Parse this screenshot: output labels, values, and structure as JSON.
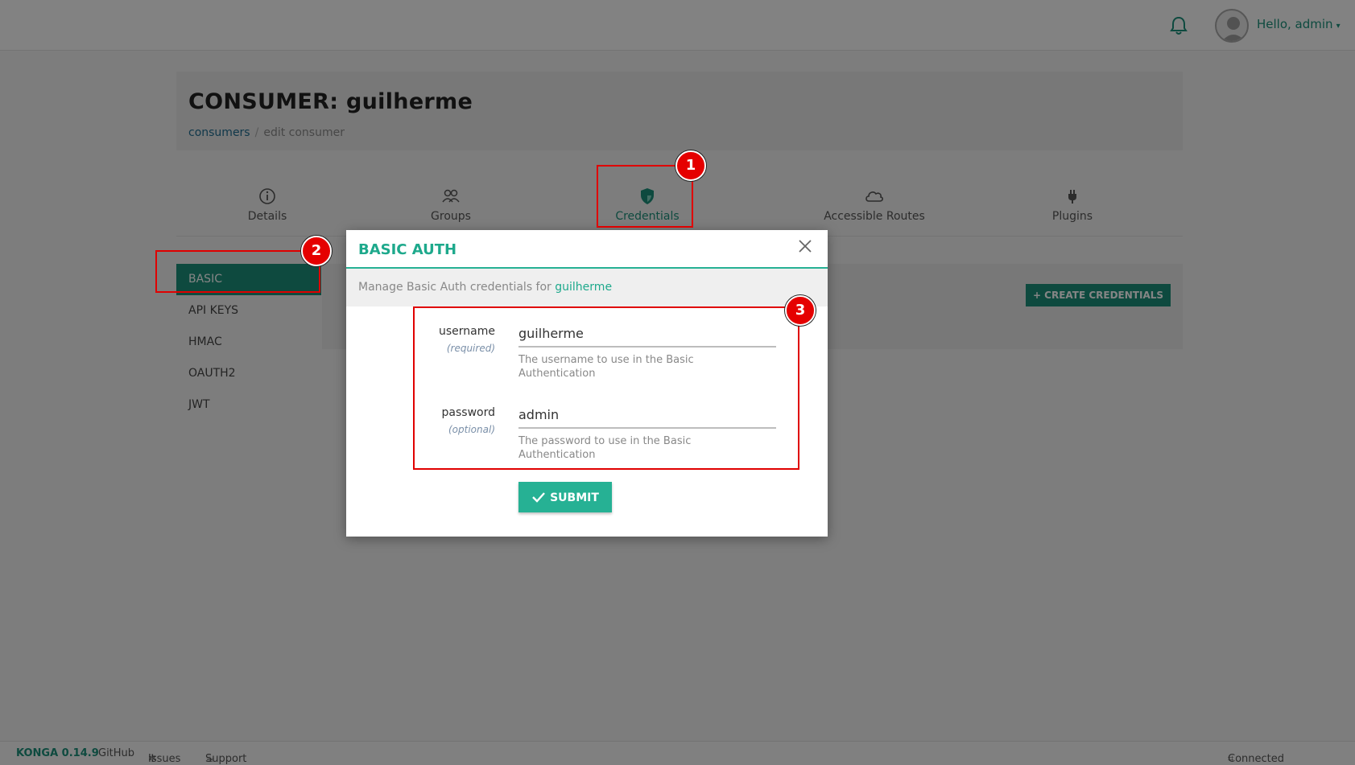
{
  "topbar": {
    "greeting": "Hello, admin",
    "caret": "▾",
    "icons": [
      "bell-icon",
      "avatar-icon"
    ]
  },
  "header": {
    "title": "CONSUMER: guilherme",
    "breadcrumb": {
      "link": "consumers",
      "separator": "/",
      "current": "edit consumer"
    }
  },
  "tabs": [
    {
      "label": "Details",
      "icon": "info-icon"
    },
    {
      "label": "Groups",
      "icon": "users-icon"
    },
    {
      "label": "Credentials",
      "icon": "shield-icon",
      "active": true
    },
    {
      "label": "Accessible Routes",
      "icon": "cloud-icon"
    },
    {
      "label": "Plugins",
      "icon": "plug-icon"
    }
  ],
  "sidebar": {
    "items": [
      "BASIC",
      "API KEYS",
      "HMAC",
      "OAUTH2",
      "JWT"
    ],
    "active": "BASIC"
  },
  "content": {
    "create_button": "+ CREATE CREDENTIALS"
  },
  "modal": {
    "title": "BASIC AUTH",
    "subtitle_prefix": "Manage Basic Auth credentials for",
    "subtitle_name": "guilherme",
    "fields": [
      {
        "label": "username",
        "hint": "(required)",
        "value": "guilherme",
        "help": "The username to use in the Basic Authentication"
      },
      {
        "label": "password",
        "hint": "(optional)",
        "value": "admin",
        "help": "The password to use in the Basic Authentication"
      }
    ],
    "submit_label": "SUBMIT"
  },
  "annotations": [
    "1",
    "2",
    "3"
  ],
  "footer": {
    "version": "KONGA 0.14.9",
    "github": "GitHub",
    "issues": "Issues",
    "support": "Support the project",
    "connection": "Connected to local"
  },
  "colors": {
    "accent": "#1c8f7a",
    "modal_accent": "#26b194",
    "annotation": "#e00000"
  }
}
